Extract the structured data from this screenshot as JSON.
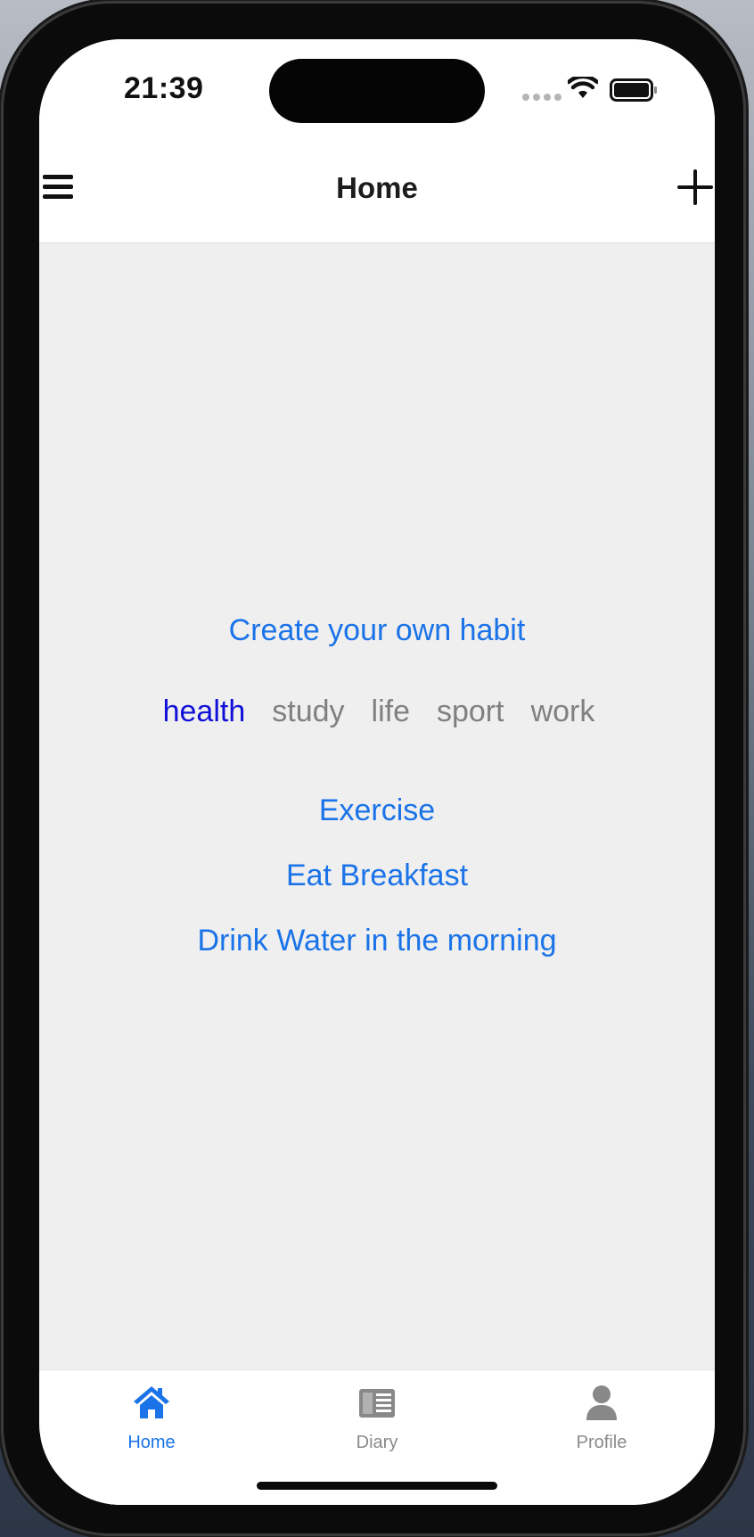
{
  "status_bar": {
    "time": "21:39"
  },
  "header": {
    "title": "Home",
    "menu_icon": "hamburger-menu-icon",
    "add_icon": "plus-icon"
  },
  "main": {
    "create_link": "Create your own habit",
    "categories": [
      {
        "label": "health",
        "active": true
      },
      {
        "label": "study",
        "active": false
      },
      {
        "label": "life",
        "active": false
      },
      {
        "label": "sport",
        "active": false
      },
      {
        "label": "work",
        "active": false
      }
    ],
    "habits": [
      "Exercise",
      "Eat Breakfast",
      "Drink Water in the morning"
    ]
  },
  "tab_bar": {
    "tabs": [
      {
        "label": "Home",
        "icon": "home-icon",
        "active": true
      },
      {
        "label": "Diary",
        "icon": "diary-icon",
        "active": false
      },
      {
        "label": "Profile",
        "icon": "profile-icon",
        "active": false
      }
    ]
  },
  "colors": {
    "accent": "#1a73e8",
    "active_category": "#1010d8",
    "inactive": "#808080",
    "background": "#efefef"
  }
}
